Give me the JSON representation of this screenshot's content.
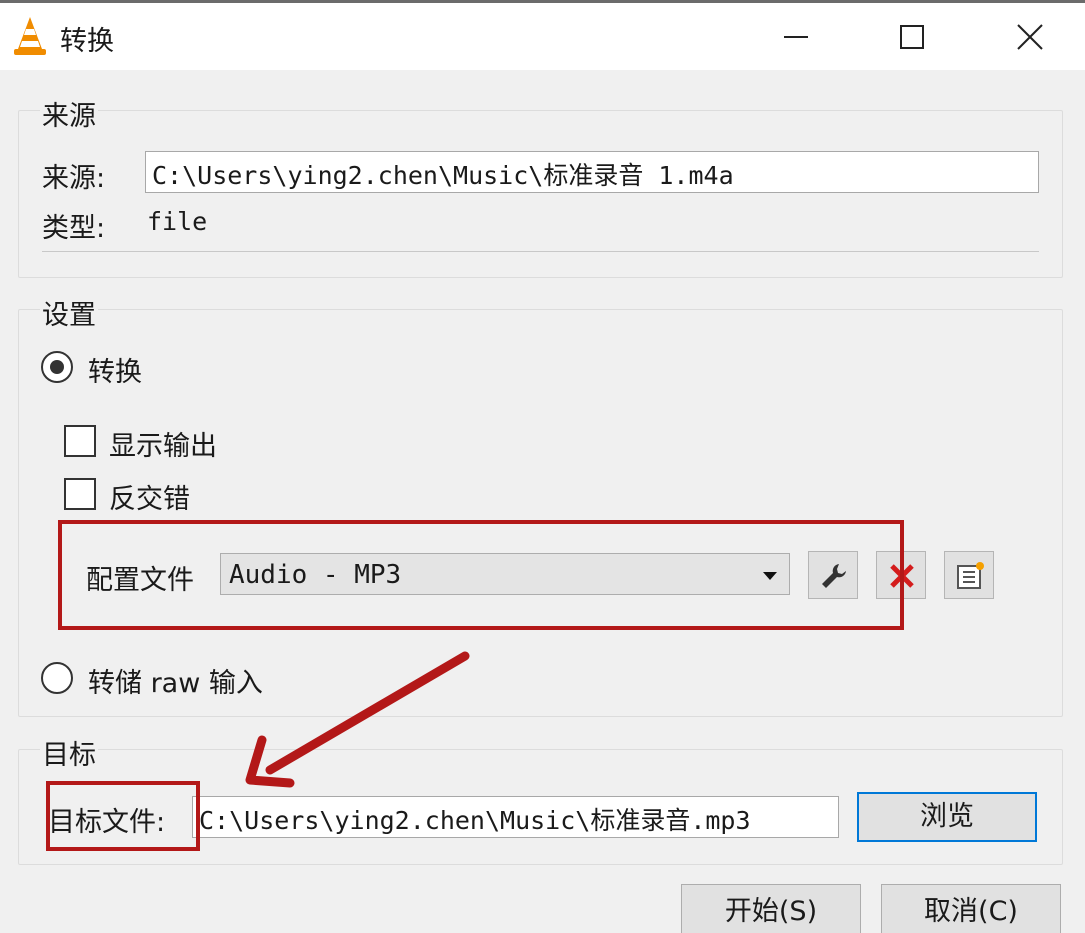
{
  "window": {
    "title": "转换",
    "icon": "vlc-cone-icon"
  },
  "source": {
    "group_label": "来源",
    "source_label": "来源:",
    "source_value": "C:\\Users\\ying2.chen\\Music\\标准录音 1.m4a",
    "type_label": "类型:",
    "type_value": "file"
  },
  "settings": {
    "group_label": "设置",
    "convert_label": "转换",
    "convert_selected": true,
    "show_output_label": "显示输出",
    "show_output_checked": false,
    "deinterlace_label": "反交错",
    "deinterlace_checked": false,
    "profile_label": "配置文件",
    "profile_value": "Audio - MP3",
    "dump_raw_label": "转储 raw 输入",
    "dump_raw_selected": false
  },
  "destination": {
    "group_label": "目标",
    "file_label": "目标文件:",
    "file_value": "C:\\Users\\ying2.chen\\Music\\标准录音.mp3",
    "browse_label": "浏览"
  },
  "footer": {
    "start_label": "开始(S)",
    "cancel_label": "取消(C)"
  },
  "colors": {
    "annotation_red": "#b31818",
    "focus_blue": "#0078d7",
    "delete_red": "#d41c1c"
  }
}
